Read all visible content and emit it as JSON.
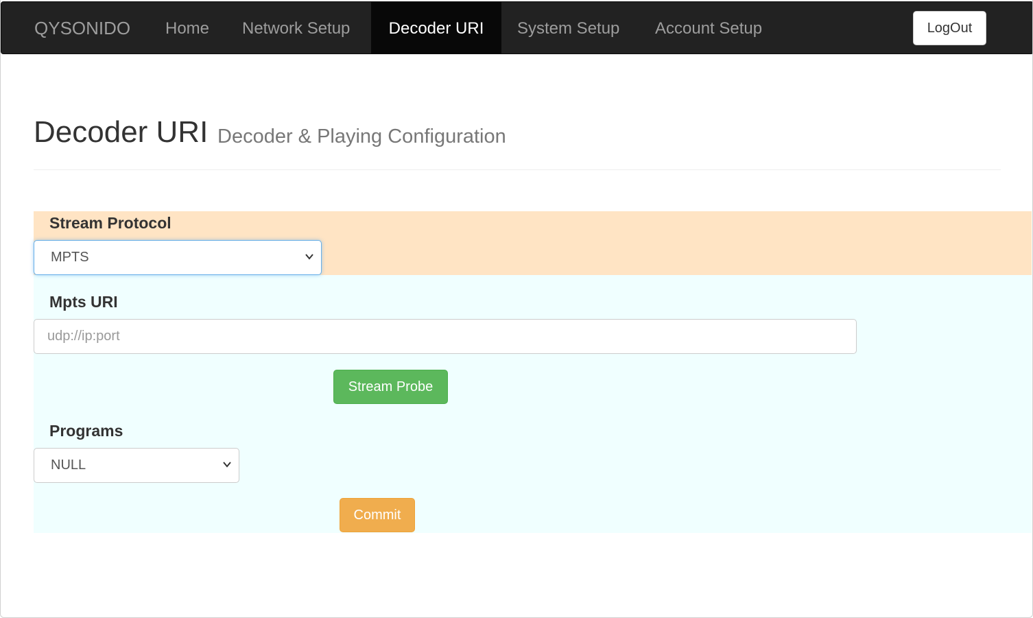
{
  "navbar": {
    "brand": "QYSONIDO",
    "items": [
      {
        "label": "Home",
        "active": false
      },
      {
        "label": "Network Setup",
        "active": false
      },
      {
        "label": "Decoder URI",
        "active": true
      },
      {
        "label": "System Setup",
        "active": false
      },
      {
        "label": "Account Setup",
        "active": false
      }
    ],
    "logout_label": "LogOut"
  },
  "header": {
    "title": "Decoder URI",
    "subtitle": "Decoder & Playing Configuration"
  },
  "stream_protocol": {
    "label": "Stream Protocol",
    "selected": "MPTS"
  },
  "mpts_uri": {
    "label": "Mpts URI",
    "placeholder": "udp://ip:port",
    "value": ""
  },
  "probe_button_label": "Stream Probe",
  "programs": {
    "label": "Programs",
    "selected": "NULL"
  },
  "commit_button_label": "Commit",
  "colors": {
    "navbar_bg": "#222222",
    "protocol_panel_bg": "#ffe4c4",
    "uri_panel_bg": "#f0ffff",
    "probe_button": "#5cb85c",
    "commit_button": "#f0ad4e"
  }
}
